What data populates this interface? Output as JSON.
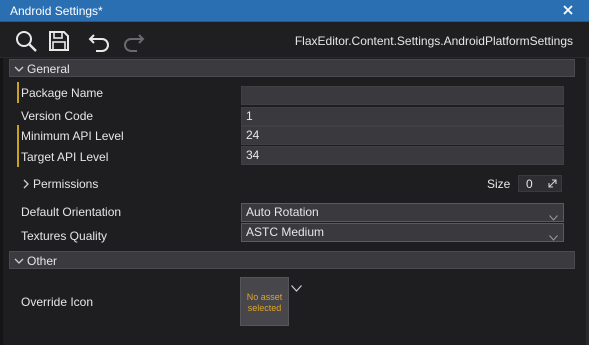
{
  "window": {
    "title": "Android Settings*",
    "asset_path": "FlaxEditor.Content.Settings.AndroidPlatformSettings"
  },
  "toolbar": {
    "icons": [
      "search-icon",
      "save-icon",
      "undo-icon",
      "redo-icon"
    ]
  },
  "groups": {
    "general": {
      "label": "General",
      "package_name": {
        "label": "Package Name",
        "value": ""
      },
      "version_code": {
        "label": "Version Code",
        "value": "1"
      },
      "minimum_api_level": {
        "label": "Minimum API Level",
        "value": "24"
      },
      "target_api_level": {
        "label": "Target API Level",
        "value": "34"
      },
      "permissions": {
        "label": "Permissions",
        "size_label": "Size",
        "size_value": "0"
      },
      "default_orientation": {
        "label": "Default Orientation",
        "value": "Auto Rotation"
      },
      "textures_quality": {
        "label": "Textures Quality",
        "value": "ASTC Medium"
      }
    },
    "other": {
      "label": "Other",
      "override_icon": {
        "label": "Override Icon",
        "asset_text": "No asset selected"
      }
    }
  },
  "colors": {
    "titlebar": "#2b6fb3",
    "modified_marker": "#c8a323",
    "no_asset_text": "#e0a52a"
  }
}
